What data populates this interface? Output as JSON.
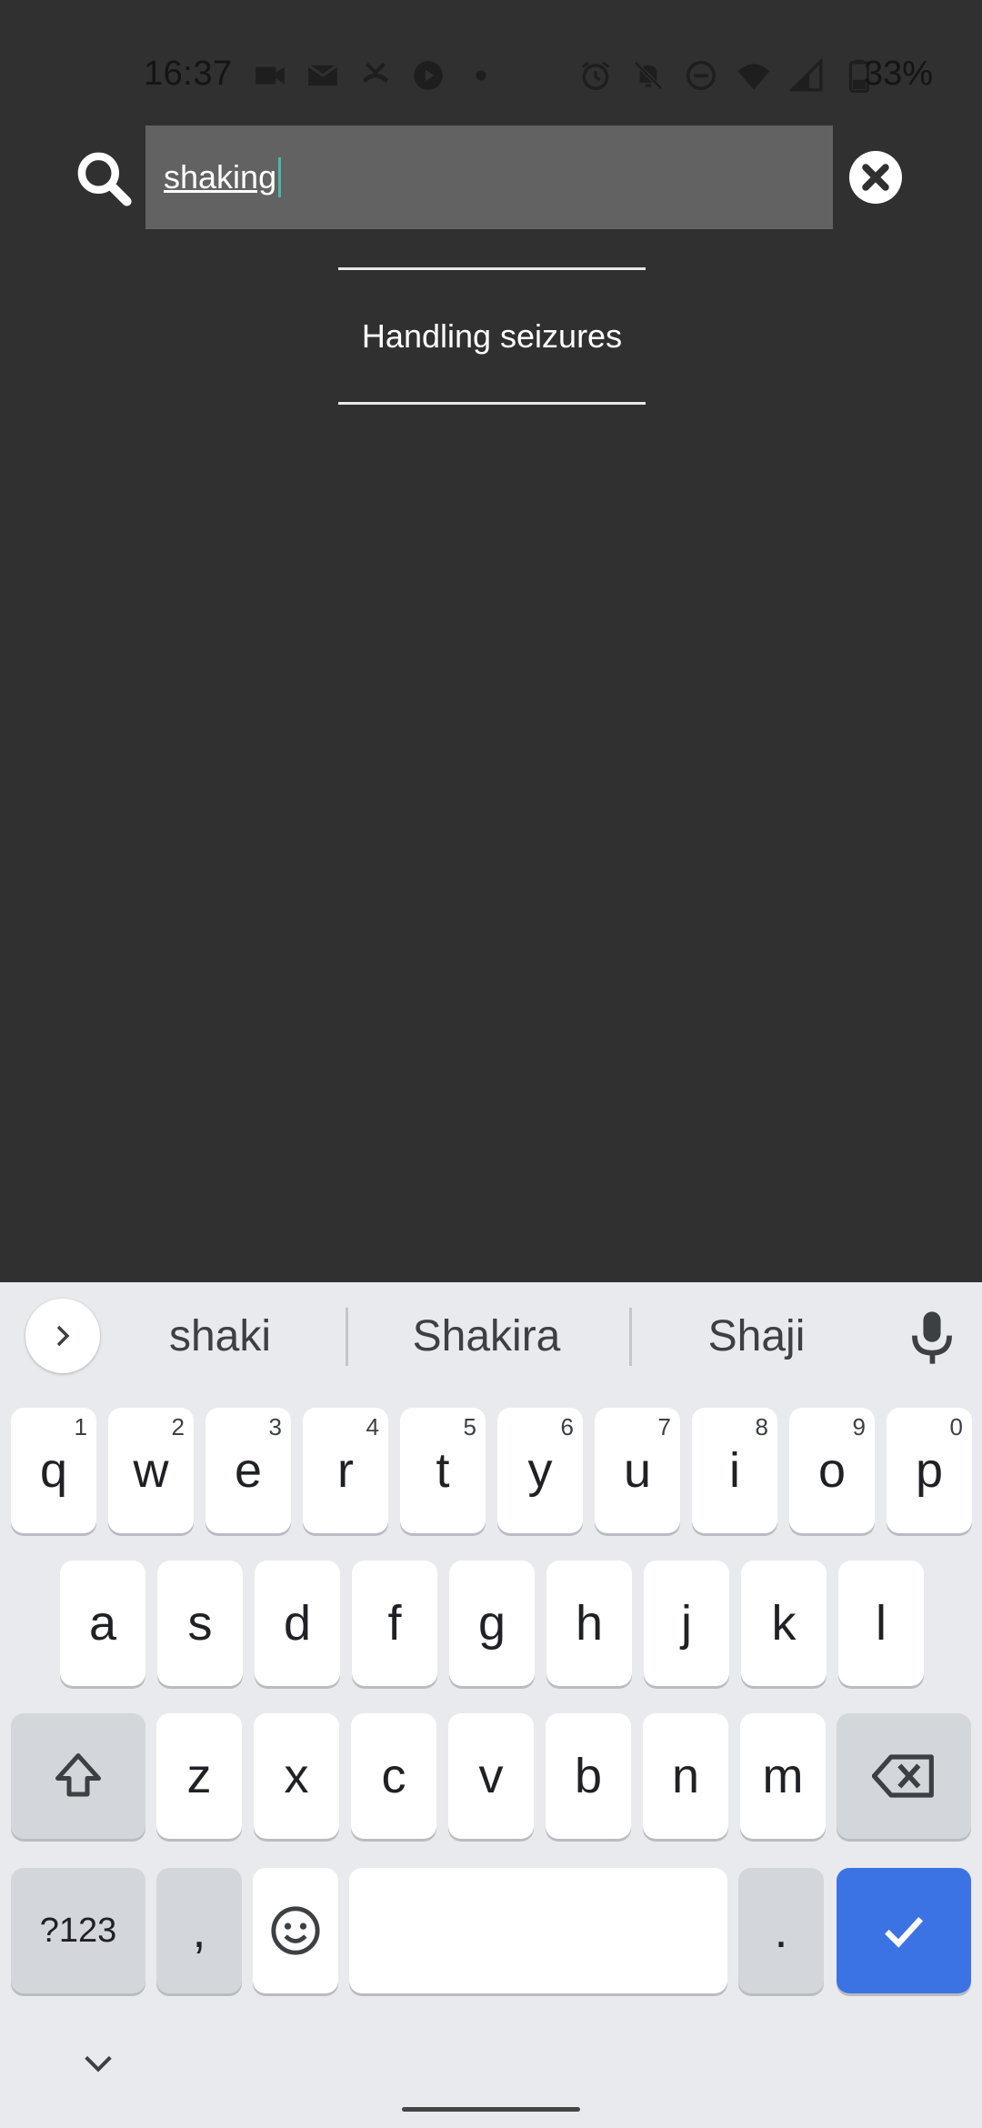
{
  "status_bar": {
    "time": "16:37",
    "battery_pct": "33%",
    "icons_left": [
      "video-icon",
      "mail-icon",
      "missed-call-icon",
      "play-icon",
      "dot-icon"
    ],
    "icons_right": [
      "alarm-icon",
      "mute-icon",
      "dnd-icon",
      "wifi-icon",
      "signal-icon",
      "battery-icon"
    ]
  },
  "search": {
    "value": "shaking"
  },
  "results": [
    {
      "label": "Handling seizures"
    }
  ],
  "keyboard": {
    "suggestions": [
      "shaki",
      "Shakira",
      "Shaji"
    ],
    "row1": [
      {
        "k": "q",
        "h": "1"
      },
      {
        "k": "w",
        "h": "2"
      },
      {
        "k": "e",
        "h": "3"
      },
      {
        "k": "r",
        "h": "4"
      },
      {
        "k": "t",
        "h": "5"
      },
      {
        "k": "y",
        "h": "6"
      },
      {
        "k": "u",
        "h": "7"
      },
      {
        "k": "i",
        "h": "8"
      },
      {
        "k": "o",
        "h": "9"
      },
      {
        "k": "p",
        "h": "0"
      }
    ],
    "row2": [
      "a",
      "s",
      "d",
      "f",
      "g",
      "h",
      "j",
      "k",
      "l"
    ],
    "row3": [
      "z",
      "x",
      "c",
      "v",
      "b",
      "n",
      "m"
    ],
    "symbols_label": "?123",
    "comma_label": ",",
    "period_label": ".",
    "accent_color": "#3c73e4"
  }
}
